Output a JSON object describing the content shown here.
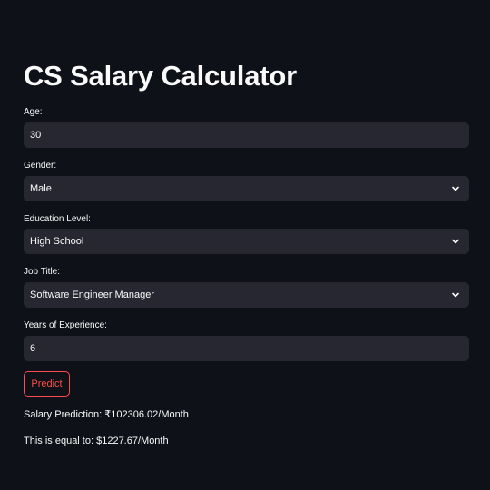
{
  "app": {
    "title": "CS Salary Calculator"
  },
  "form": {
    "age": {
      "label": "Age:",
      "value": "30"
    },
    "gender": {
      "label": "Gender:",
      "value": "Male"
    },
    "education": {
      "label": "Education Level:",
      "value": "High School"
    },
    "job_title": {
      "label": "Job Title:",
      "value": "Software Engineer Manager"
    },
    "experience": {
      "label": "Years of Experience:",
      "value": "6"
    }
  },
  "actions": {
    "predict_label": "Predict"
  },
  "results": {
    "prediction": "Salary Prediction: ₹102306.02/Month",
    "usd": "This is equal to: $1227.67/Month"
  },
  "colors": {
    "background": "#0e1117",
    "field": "#262730",
    "accent": "#ff4b4b",
    "text": "#fafafa"
  },
  "icons": {
    "select_chevron": "chevron-down-icon"
  }
}
